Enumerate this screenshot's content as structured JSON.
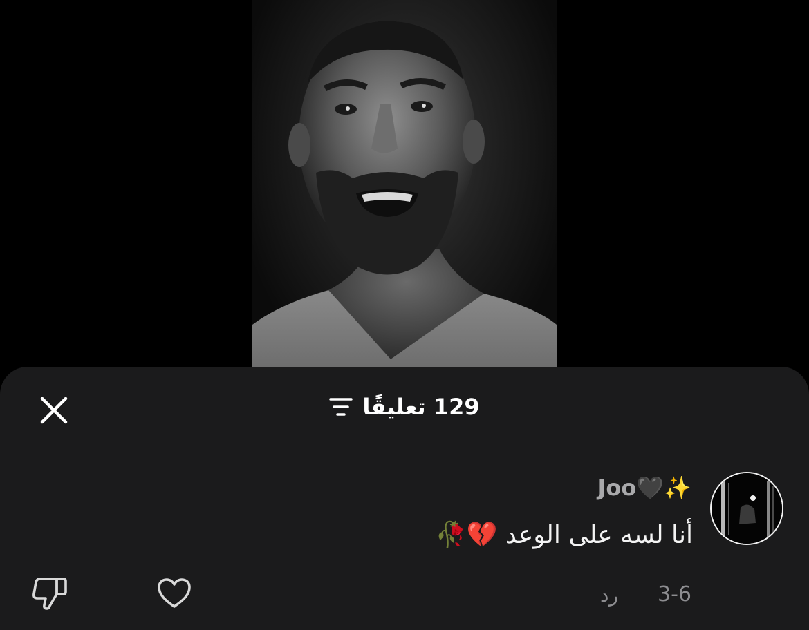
{
  "video": {
    "description_icon": "video-frame"
  },
  "sheet": {
    "title": "129 تعليقًا",
    "close_icon": "close-icon",
    "filter_icon": "sort-filter-icon"
  },
  "comments": [
    {
      "username": "Joo🖤✨",
      "text": "أنا لسه على الوعد 💔🥀",
      "date": "3-6",
      "reply_label": "رد",
      "like_icon": "heart-icon",
      "dislike_icon": "thumbs-down-icon"
    }
  ],
  "colors": {
    "sheet_background": "#1b1b1c",
    "username": "#a9a9ab",
    "comment_text": "#f4f4f4",
    "meta_text": "#8d8d90"
  }
}
